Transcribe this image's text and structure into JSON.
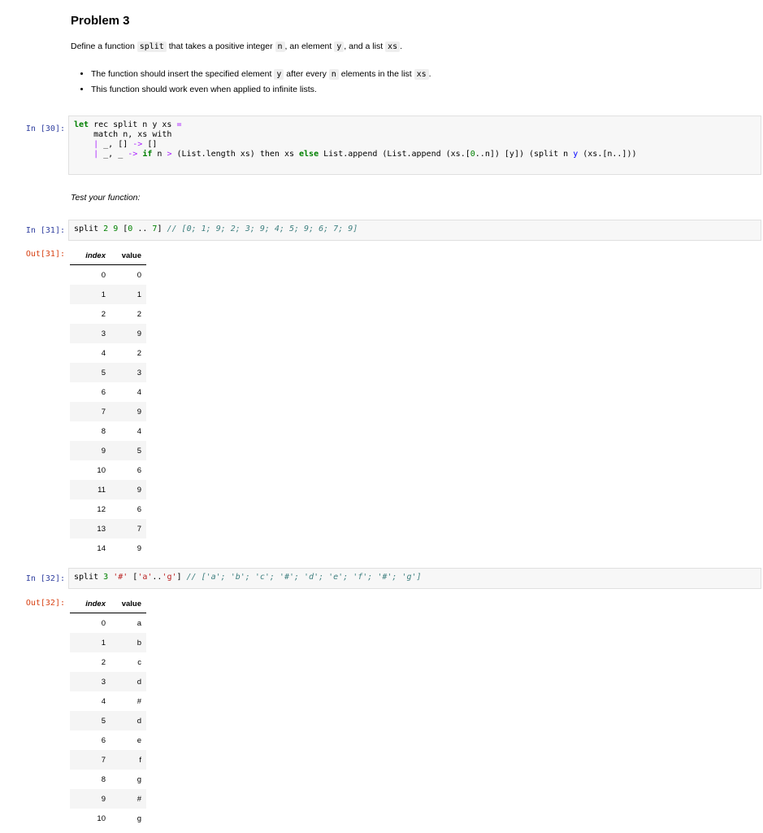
{
  "problem": {
    "title": "Problem 3",
    "desc": {
      "p1": "Define a function ",
      "c1": "split",
      "p2": " that takes a positive integer ",
      "c2": "n",
      "p3": ", an element ",
      "c3": "y",
      "p4": ", and a list ",
      "c4": "xs",
      "p5": "."
    },
    "bullet1": {
      "p1": "The function should insert the specified element ",
      "c1": "y",
      "p2": " after every ",
      "c2": "n",
      "p3": " elements in the list ",
      "c3": "xs",
      "p4": "."
    },
    "bullet2": "This function should work even when applied to infinite lists."
  },
  "cell30": {
    "prompt": "In [30]:",
    "l1": {
      "kw_let": "let",
      "rest": " rec split n y xs ",
      "eq": "="
    },
    "l2": "    match n, xs with",
    "l3": {
      "indent": "    ",
      "bar": "|",
      "pat": " _, [] ",
      "arrow": "->",
      "res": " []"
    },
    "l4": {
      "indent": "    ",
      "bar": "|",
      "pat": " _, _ ",
      "arrow": "->",
      "sp": " ",
      "kw_if": "if",
      "a": " n ",
      "gt": ">",
      "b": " (List.length xs) then xs ",
      "kw_else": "else",
      "c": " List.append (List.append (xs.[",
      "z": "0",
      "d": "..n]) [y]) (split n ",
      "y": "y",
      "e": " (xs.[n..]))"
    }
  },
  "test_label": "Test your function:",
  "cell31": {
    "prompt": "In [31]:",
    "code": {
      "fn": "split",
      "sp1": " ",
      "n1": "2",
      "sp2": " ",
      "n2": "9",
      "a": " [",
      "n3": "0",
      "b": " .. ",
      "n4": "7",
      "c": "] ",
      "comment": "// [0; 1; 9; 2; 3; 9; 4; 5; 9; 6; 7; 9]"
    },
    "out_prompt": "Out[31]:",
    "headers": {
      "index": "index",
      "value": "value"
    },
    "rows": [
      [
        "0",
        "0"
      ],
      [
        "1",
        "1"
      ],
      [
        "2",
        "2"
      ],
      [
        "3",
        "9"
      ],
      [
        "4",
        "2"
      ],
      [
        "5",
        "3"
      ],
      [
        "6",
        "4"
      ],
      [
        "7",
        "9"
      ],
      [
        "8",
        "4"
      ],
      [
        "9",
        "5"
      ],
      [
        "10",
        "6"
      ],
      [
        "11",
        "9"
      ],
      [
        "12",
        "6"
      ],
      [
        "13",
        "7"
      ],
      [
        "14",
        "9"
      ]
    ]
  },
  "cell32": {
    "prompt": "In [32]:",
    "code": {
      "fn": "split",
      "sp1": " ",
      "n1": "3",
      "sp2": " ",
      "s1": "'#'",
      "a": " [",
      "s2": "'a'",
      "b": "..",
      "s3": "'g'",
      "c": "] ",
      "comment": "// ['a'; 'b'; 'c'; '#'; 'd'; 'e'; 'f'; '#'; 'g']"
    },
    "out_prompt": "Out[32]:",
    "headers": {
      "index": "index",
      "value": "value"
    },
    "rows": [
      [
        "0",
        "a"
      ],
      [
        "1",
        "b"
      ],
      [
        "2",
        "c"
      ],
      [
        "3",
        "d"
      ],
      [
        "4",
        "#"
      ],
      [
        "5",
        "d"
      ],
      [
        "6",
        "e"
      ],
      [
        "7",
        "f"
      ],
      [
        "8",
        "g"
      ],
      [
        "9",
        "#"
      ],
      [
        "10",
        "g"
      ]
    ]
  }
}
